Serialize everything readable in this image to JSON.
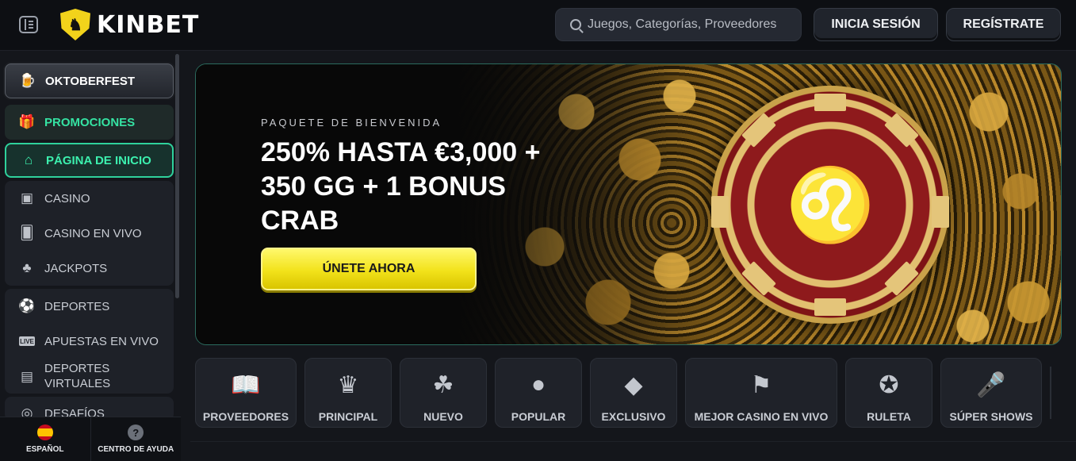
{
  "header": {
    "brand": "KINBET",
    "search_placeholder": "Juegos, Categorías, Proveedores",
    "login_label": "INICIA SESIÓN",
    "register_label": "REGÍSTRATE"
  },
  "sidebar": {
    "featured": "OKTOBERFEST",
    "promotions": "PROMOCIONES",
    "home": "PÁGINA DE INICIO",
    "casino_group": [
      {
        "label": "CASINO",
        "icon": "slot-machine-icon"
      },
      {
        "label": "CASINO EN VIVO",
        "icon": "card-icon"
      },
      {
        "label": "JACKPOTS",
        "icon": "clover-icon"
      }
    ],
    "sports_group": [
      {
        "label": "DEPORTES",
        "icon": "soccer-ball-icon"
      },
      {
        "label": "APUESTAS EN VIVO",
        "icon": "live-icon"
      },
      {
        "label": "DEPORTES VIRTUALES",
        "icon": "virtual-sports-icon"
      }
    ],
    "more": "DESAFÍOS",
    "language": "ESPAÑOL",
    "help": "CENTRO DE AYUDA",
    "live_badge": "LIVE"
  },
  "hero": {
    "subtitle": "PAQUETE DE BIENVENIDA",
    "title": "250% HASTA €3,000 + 350 GG + 1 BONUS CRAB",
    "cta": "ÚNETE AHORA"
  },
  "categories": [
    {
      "label": "PROVEEDORES",
      "icon": "book-icon"
    },
    {
      "label": "PRINCIPAL",
      "icon": "crown-icon"
    },
    {
      "label": "NUEVO",
      "icon": "clover-icon"
    },
    {
      "label": "POPULAR",
      "icon": "bomb-icon"
    },
    {
      "label": "EXCLUSIVO",
      "icon": "diamond-icon"
    },
    {
      "label": "MEJOR CASINO EN VIVO",
      "icon": "flag-icon"
    },
    {
      "label": "RULETA",
      "icon": "roulette-icon"
    },
    {
      "label": "SÚPER SHOWS",
      "icon": "microphone-icon"
    }
  ],
  "colors": {
    "accent_green": "#3cf0ae",
    "cta_yellow": "#f2e21a",
    "brand_yellow": "#f2d31b"
  }
}
